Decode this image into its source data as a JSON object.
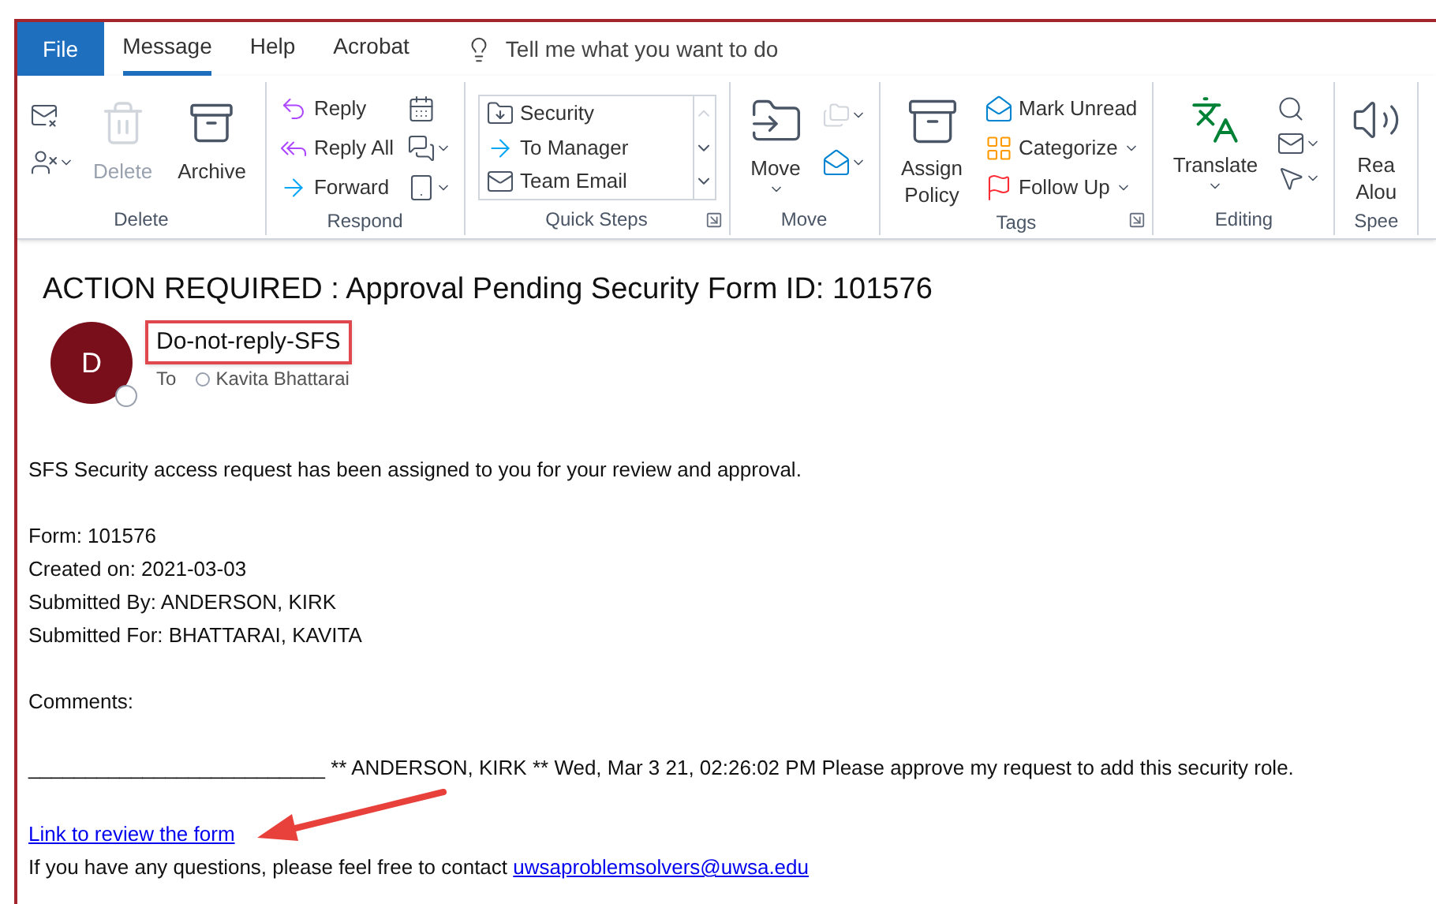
{
  "tabs": [
    {
      "label": "File",
      "kind": "file",
      "selected": false
    },
    {
      "label": "Message",
      "kind": "tab",
      "selected": true
    },
    {
      "label": "Help",
      "kind": "tab",
      "selected": false
    },
    {
      "label": "Acrobat",
      "kind": "tab",
      "selected": false
    }
  ],
  "tell_me": "Tell me what you want to do",
  "ribbon": [
    {
      "label": "Delete",
      "launcher": false,
      "buttons": [
        {
          "label": "Delete",
          "disabled": true
        },
        {
          "label": "Archive",
          "disabled": false
        }
      ]
    },
    {
      "label": "Respond",
      "launcher": false,
      "buttons": [
        {
          "label": "Reply"
        },
        {
          "label": "Reply All"
        },
        {
          "label": "Forward"
        }
      ]
    },
    {
      "label": "Quick Steps",
      "launcher": true,
      "buttons": [
        {
          "label": "Security"
        },
        {
          "label": "To Manager"
        },
        {
          "label": "Team Email"
        }
      ]
    },
    {
      "label": "Move",
      "launcher": false,
      "buttons": [
        {
          "label": "Move"
        }
      ]
    },
    {
      "label": "Tags",
      "launcher": true,
      "buttons": [
        {
          "label": "Assign Policy"
        },
        {
          "label": "Mark Unread"
        },
        {
          "label": "Categorize"
        },
        {
          "label": "Follow Up"
        }
      ]
    },
    {
      "label": "Editing",
      "launcher": false,
      "buttons": [
        {
          "label": "Translate"
        }
      ]
    },
    {
      "label": "Spee",
      "launcher": false,
      "buttons": [
        {
          "label": "Rea Alou"
        }
      ]
    }
  ],
  "email": {
    "subject": "ACTION REQUIRED : Approval Pending Security Form ID: 101576",
    "sender": {
      "initial": "D",
      "name": "Do-not-reply-SFS"
    },
    "to_label": "To",
    "recipient": "Kavita Bhattarai",
    "paragraphs": [
      [
        "SFS Security access request has been assigned to you for your review and approval."
      ],
      [
        "Form: 101576",
        "Created on: 2021-03-03",
        "Submitted By: ANDERSON, KIRK",
        "Submitted For: BHATTARAI, KAVITA"
      ],
      [
        "Comments:"
      ]
    ],
    "comment": "__________________________ ** ANDERSON, KIRK ** Wed, Mar 3 21, 02:26:02 PM Please approve my request to add this security role.",
    "review_link": "Link to review the form",
    "contact": {
      "text": "If you have any questions, please feel free to contact",
      "email": "uwsaproblemsolvers@uwsa.edu"
    }
  }
}
